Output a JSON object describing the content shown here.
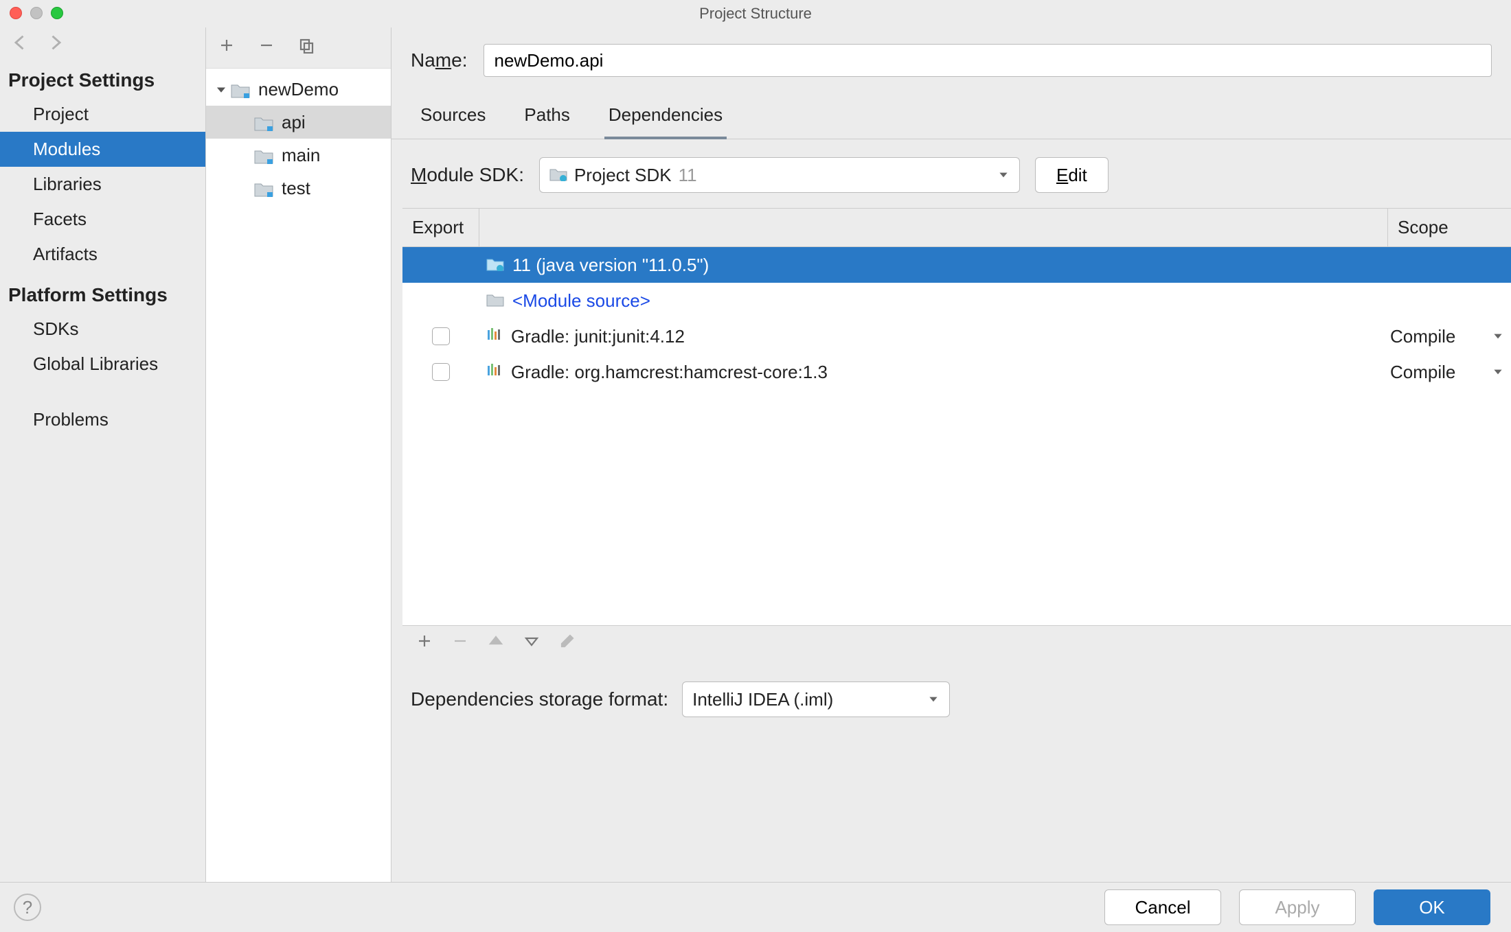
{
  "window": {
    "title": "Project Structure"
  },
  "sidebar": {
    "project_settings": {
      "header": "Project Settings",
      "items": [
        "Project",
        "Modules",
        "Libraries",
        "Facets",
        "Artifacts"
      ],
      "selected": 1
    },
    "platform_settings": {
      "header": "Platform Settings",
      "items": [
        "SDKs",
        "Global Libraries"
      ]
    },
    "problems": "Problems"
  },
  "tree": {
    "root": "newDemo",
    "children": [
      "api",
      "main",
      "test"
    ],
    "selected": "api"
  },
  "main": {
    "name_label": "Name:",
    "name_value": "newDemo.api",
    "tabs": [
      "Sources",
      "Paths",
      "Dependencies"
    ],
    "active_tab": 2,
    "module_sdk_label": "Module SDK:",
    "module_sdk_value_prefix": "Project SDK",
    "module_sdk_value_dim": "11",
    "edit_label": "Edit"
  },
  "deps": {
    "headers": {
      "export": "Export",
      "scope": "Scope"
    },
    "rows": [
      {
        "type": "sdk",
        "name": "11 (java version \"11.0.5\")",
        "selected": true
      },
      {
        "type": "source",
        "name": "<Module source>",
        "link": true
      },
      {
        "type": "lib",
        "name": "Gradle: junit:junit:4.12",
        "checkbox": true,
        "scope": "Compile"
      },
      {
        "type": "lib",
        "name": "Gradle: org.hamcrest:hamcrest-core:1.3",
        "checkbox": true,
        "scope": "Compile"
      }
    ],
    "storage_label": "Dependencies storage format:",
    "storage_value": "IntelliJ IDEA (.iml)"
  },
  "buttons": {
    "cancel": "Cancel",
    "apply": "Apply",
    "ok": "OK"
  }
}
